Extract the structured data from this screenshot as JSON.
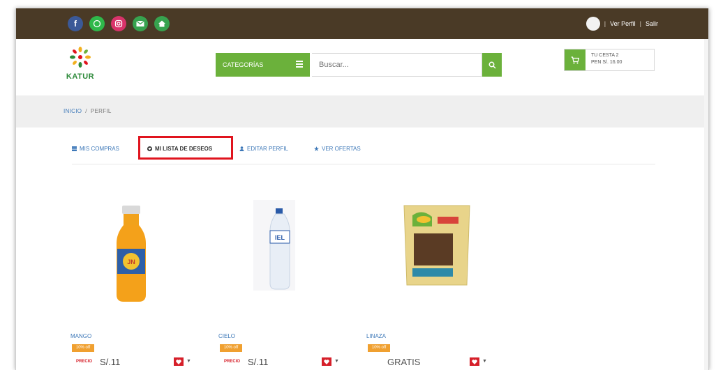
{
  "topbar": {
    "social_icons": [
      "facebook-icon",
      "whatsapp-icon",
      "instagram-icon",
      "mail-icon",
      "home-icon"
    ],
    "ver_perfil": "Ver Perfil",
    "separator": "|",
    "salir": "Salir"
  },
  "header": {
    "logo_text": "KATUR",
    "categories_label": "CATEGORÍAS",
    "search_placeholder": "Buscar...",
    "cart_line1": "TU CESTA 2",
    "cart_line2": "PEN S/. 16.00"
  },
  "breadcrumb": {
    "home": "INICIO",
    "separator": "/",
    "current": "PERFIL"
  },
  "tabs": [
    {
      "label": "MIS COMPRAS"
    },
    {
      "label": "MI LISTA DE DESEOS"
    },
    {
      "label": "EDITAR PERFIL"
    },
    {
      "label": "VER OFERTAS"
    }
  ],
  "products": [
    {
      "name": "MANGO",
      "badge": "10% off",
      "price_tag": "PRECIO",
      "price": "S/.11"
    },
    {
      "name": "CIELO",
      "badge": "10% off",
      "price_tag": "PRECIO",
      "price": "S/.11"
    },
    {
      "name": "LINAZA",
      "badge": "10% off",
      "price_tag": "",
      "price": "GRATIS"
    }
  ],
  "colors": {
    "topbar": "#4a3a26",
    "accent_green": "#6bb13b",
    "link_blue": "#3d78b8",
    "highlight_red": "#e0141e"
  }
}
